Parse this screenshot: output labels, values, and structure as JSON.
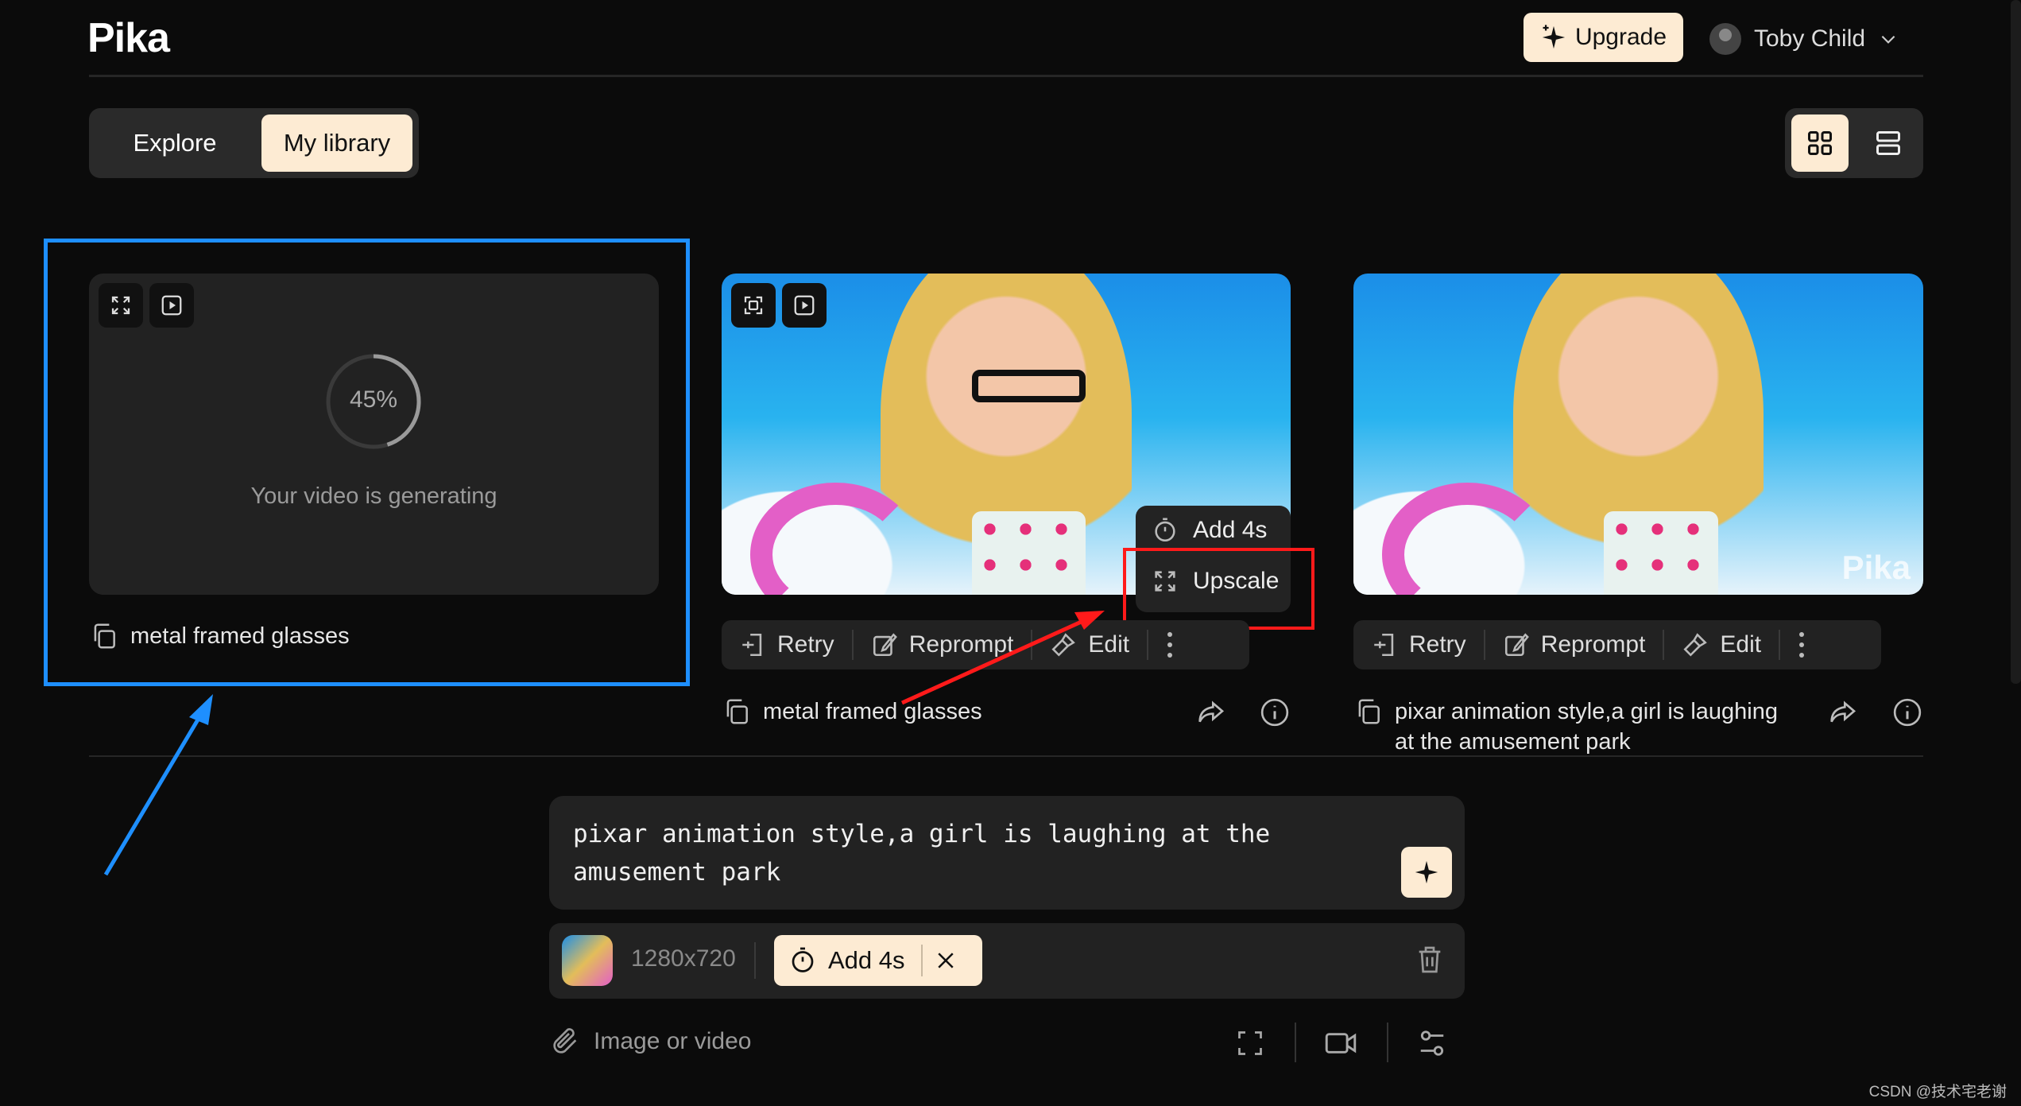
{
  "header": {
    "logo": "Pika",
    "upgrade_label": "Upgrade",
    "user_name": "Toby Child"
  },
  "tabs": [
    {
      "label": "Explore",
      "active": false
    },
    {
      "label": "My library",
      "active": true
    }
  ],
  "view_toggle": {
    "active": "grid"
  },
  "cards": [
    {
      "status": "generating",
      "progress_percent": 45,
      "progress_label": "45%",
      "message": "Your video is generating",
      "caption": "metal framed glasses",
      "highlighted": true
    },
    {
      "caption": "metal framed glasses",
      "actions": [
        "Retry",
        "Reprompt",
        "Edit"
      ],
      "menu": [
        "Add 4s",
        "Upscale"
      ]
    },
    {
      "caption": "pixar animation style,a girl is laughing at the amusement park",
      "actions": [
        "Retry",
        "Reprompt",
        "Edit"
      ],
      "watermark": "Pika"
    }
  ],
  "prompt": {
    "text": "pixar animation style,a girl is laughing at the amusement park"
  },
  "options": {
    "resolution": "1280x720",
    "chip_label": "Add 4s"
  },
  "bottom": {
    "attach_placeholder": "Image or video"
  },
  "footer_watermark": "CSDN @技术宅老谢",
  "colors": {
    "accent": "#fdebd3",
    "highlight_box": "#1e8fff",
    "annotation_red": "#ff1a1a",
    "background": "#0b0b0b"
  }
}
